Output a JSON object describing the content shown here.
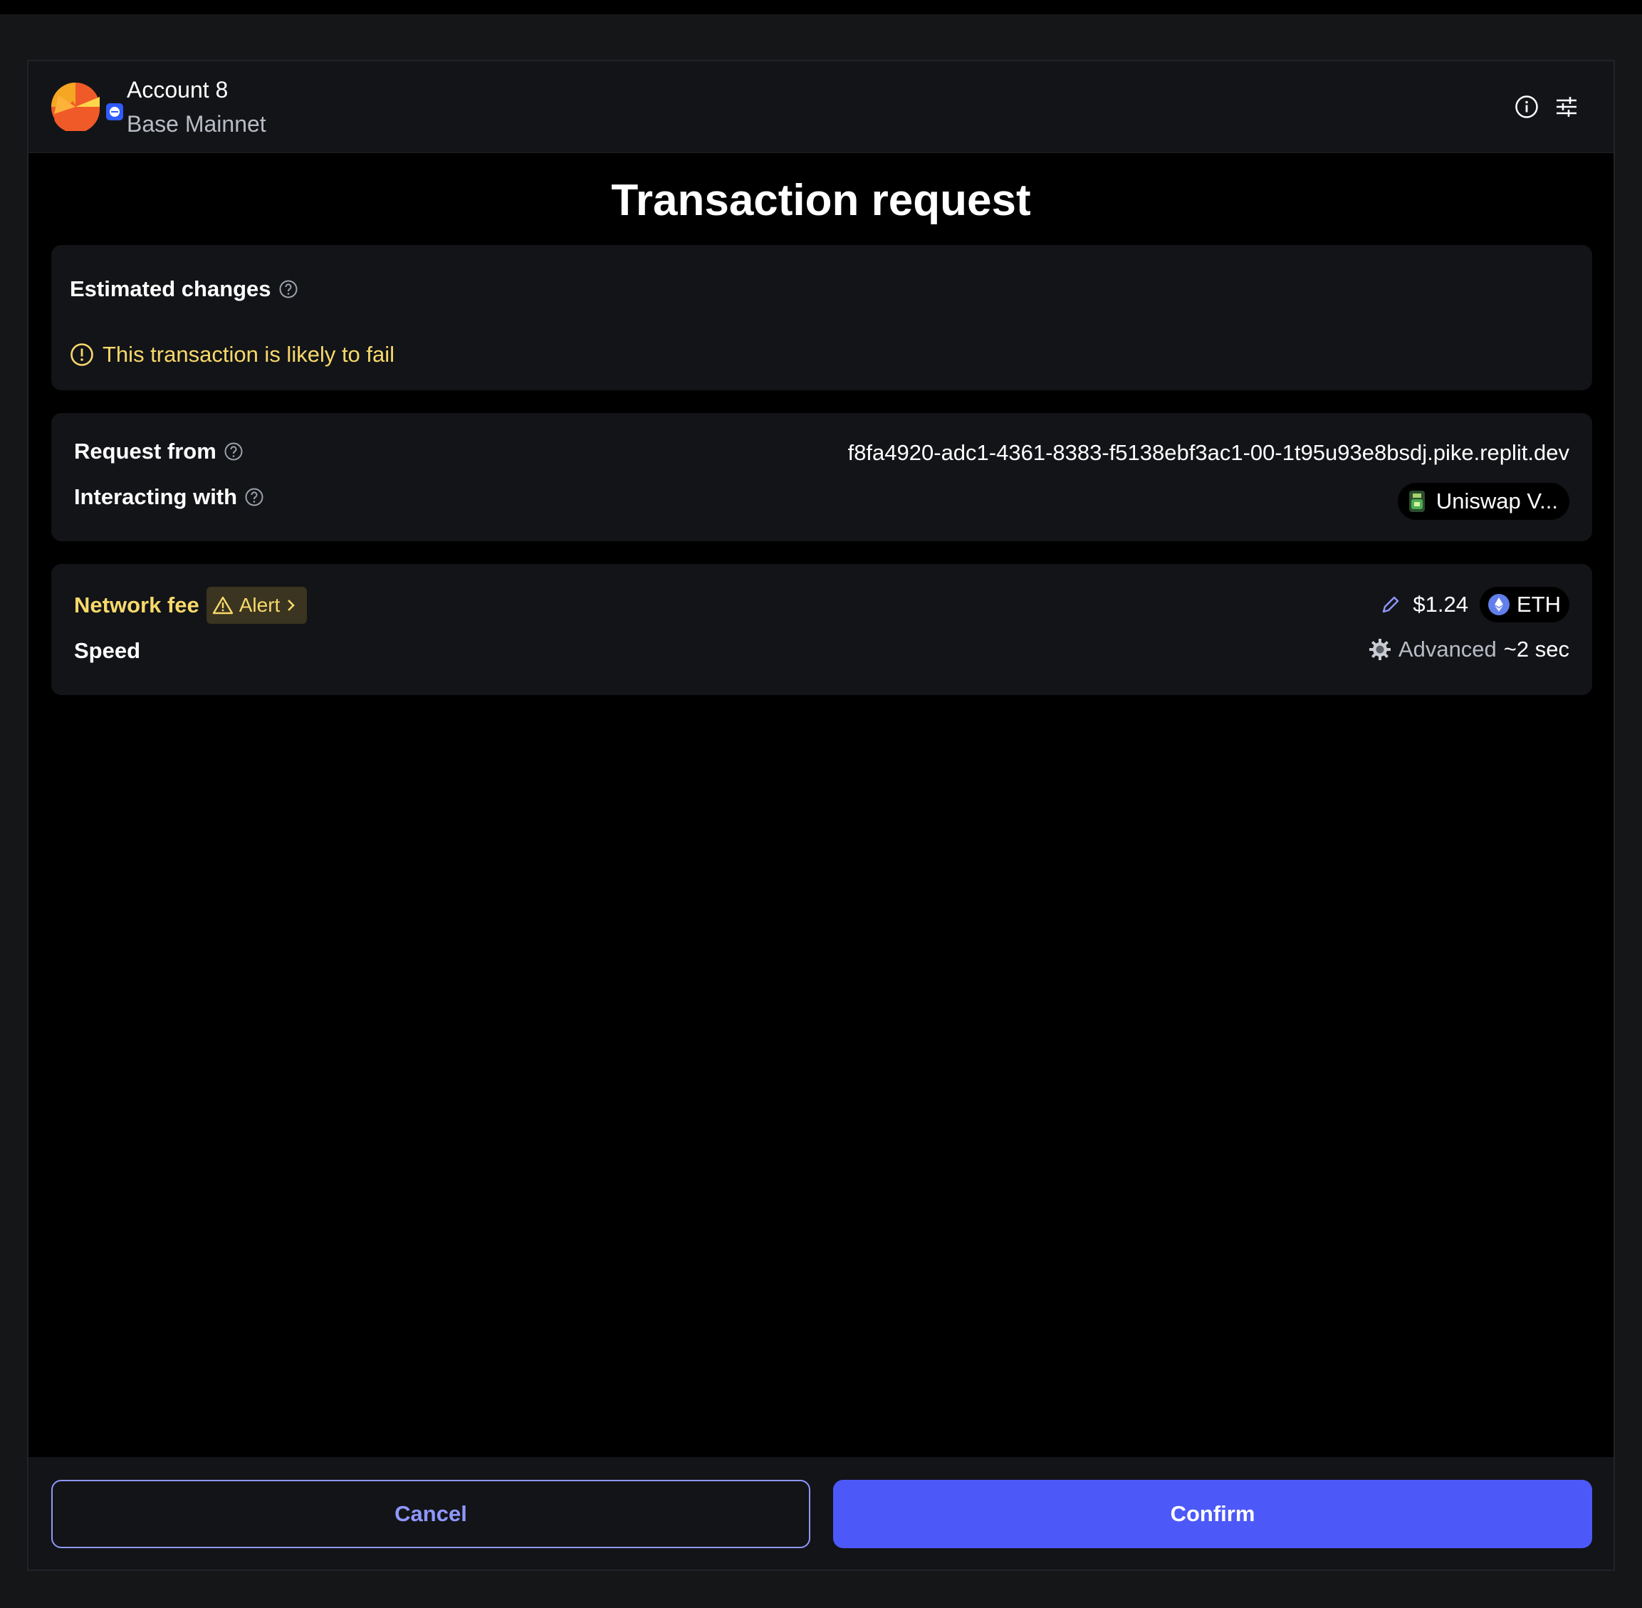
{
  "header": {
    "account_name": "Account 8",
    "network_name": "Base Mainnet",
    "avatar_colors": [
      "#f5a623",
      "#f05a28",
      "#ffd54a"
    ],
    "network_badge_color": "#2f5bff"
  },
  "page_title": "Transaction request",
  "estimated_changes": {
    "label": "Estimated changes",
    "warning": "This transaction is likely to fail",
    "warning_color": "#f8d96b"
  },
  "request": {
    "request_from_label": "Request from",
    "request_from_value": "f8fa4920-adc1-4361-8383-f5138ebf3ac1-00-1t95u93e8bsdj.pike.replit.dev",
    "interacting_with_label": "Interacting with",
    "interacting_with_value": "Uniswap V..."
  },
  "fee": {
    "network_fee_label": "Network fee",
    "alert_label": "Alert",
    "amount": "$1.24",
    "currency": "ETH",
    "speed_label": "Speed",
    "speed_mode": "Advanced",
    "speed_time": "~2 sec"
  },
  "actions": {
    "cancel_label": "Cancel",
    "confirm_label": "Confirm",
    "accent_color": "#4c59f8"
  }
}
